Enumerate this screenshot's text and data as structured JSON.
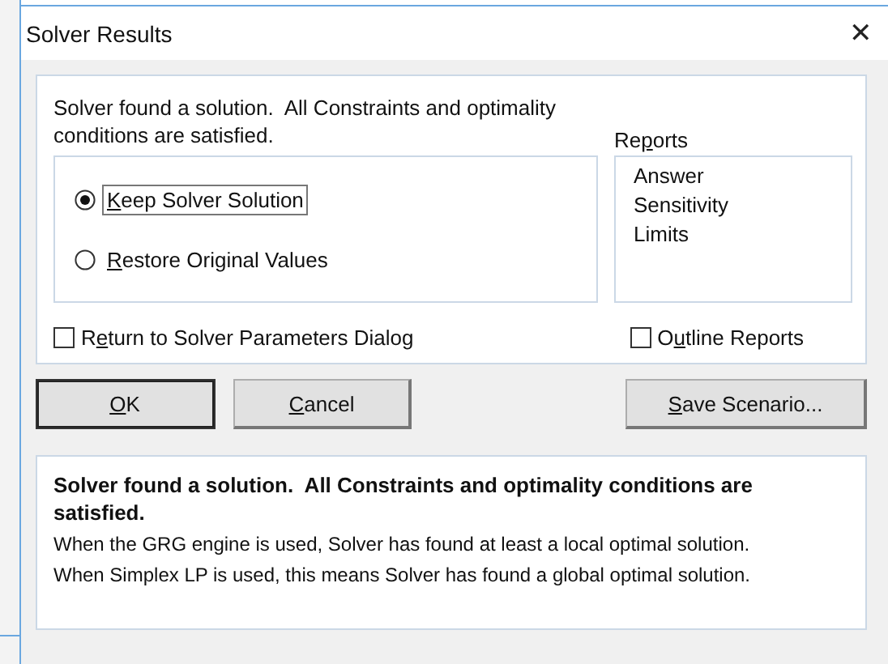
{
  "window": {
    "title": "Solver Results",
    "close": "✕"
  },
  "message": "Solver found a solution.  All Constraints and optimality conditions are satisfied.",
  "options": [
    {
      "key": "K",
      "rest": "eep Solver Solution",
      "selected": true,
      "focused": true
    },
    {
      "key": "R",
      "rest": "estore Original Values",
      "selected": false,
      "focused": false
    }
  ],
  "reports": {
    "before": "Re",
    "key": "p",
    "rest": "orts",
    "items": [
      "Answer",
      "Sensitivity",
      "Limits"
    ]
  },
  "checkboxes": [
    {
      "before": "R",
      "key": "e",
      "rest": "turn to Solver Parameters Dialog",
      "checked": false
    },
    {
      "before": "O",
      "key": "u",
      "rest": "tline Reports",
      "checked": false
    }
  ],
  "buttons": [
    {
      "key": "O",
      "rest": "K",
      "default": true
    },
    {
      "key": "C",
      "rest": "ancel",
      "default": false
    },
    {
      "key": "S",
      "rest": "ave Scenario...",
      "default": false
    }
  ],
  "details": {
    "heading": "Solver found a solution.  All Constraints and optimality conditions are satisfied.",
    "lines": [
      "When the GRG engine is used, Solver has found at least a local optimal solution.",
      "When Simplex LP is used, this means Solver has found a global optimal solution."
    ]
  }
}
